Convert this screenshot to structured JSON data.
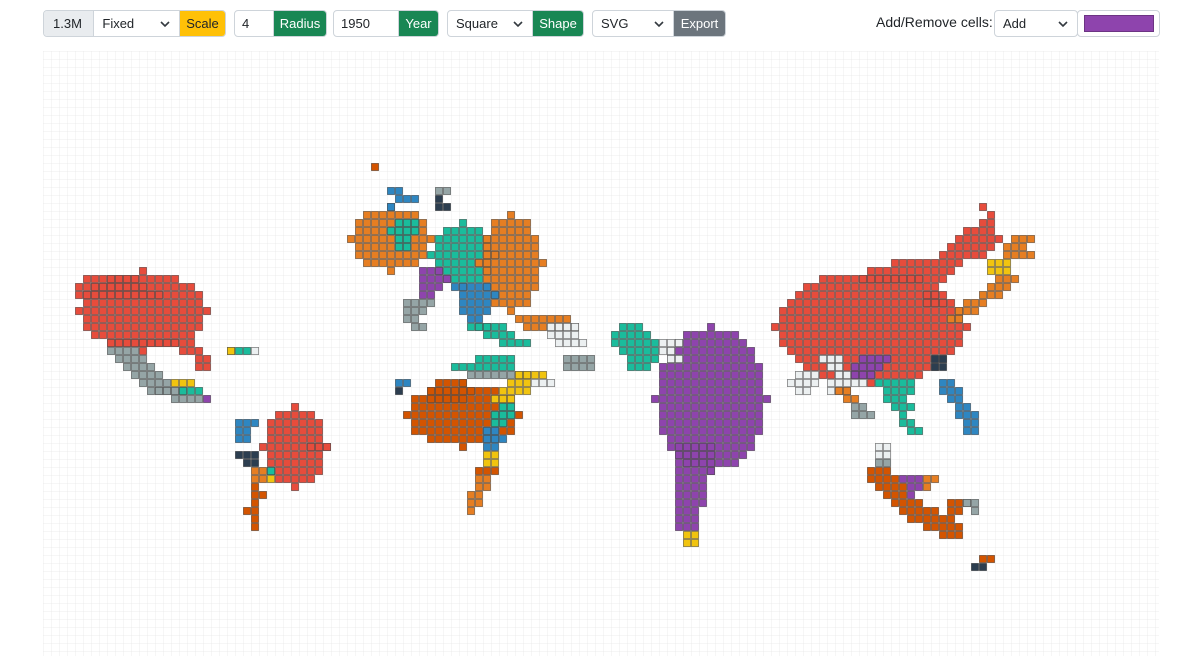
{
  "toolbar": {
    "population_label": "1.3M",
    "scale_mode": "Fixed",
    "scale_button": "Scale",
    "radius_value": "4",
    "radius_button": "Radius",
    "year_value": "1950",
    "year_button": "Year",
    "shape_value": "Square",
    "shape_button": "Shape",
    "export_format": "SVG",
    "export_button": "Export",
    "cells_label": "Add/Remove cells:",
    "cells_mode": "Add",
    "cell_color": "#8e44ad"
  },
  "colors": {
    "accent_yellow": "#ffc107",
    "accent_green": "#198754",
    "accent_grey": "#6c757d",
    "palette": [
      "#e74c3c",
      "#8e44ad",
      "#e67e22",
      "#d35400",
      "#1abc9c",
      "#2e86c1",
      "#f1c40f",
      "#95a5a6",
      "#2c3e50",
      "#ecf0f1"
    ]
  }
}
